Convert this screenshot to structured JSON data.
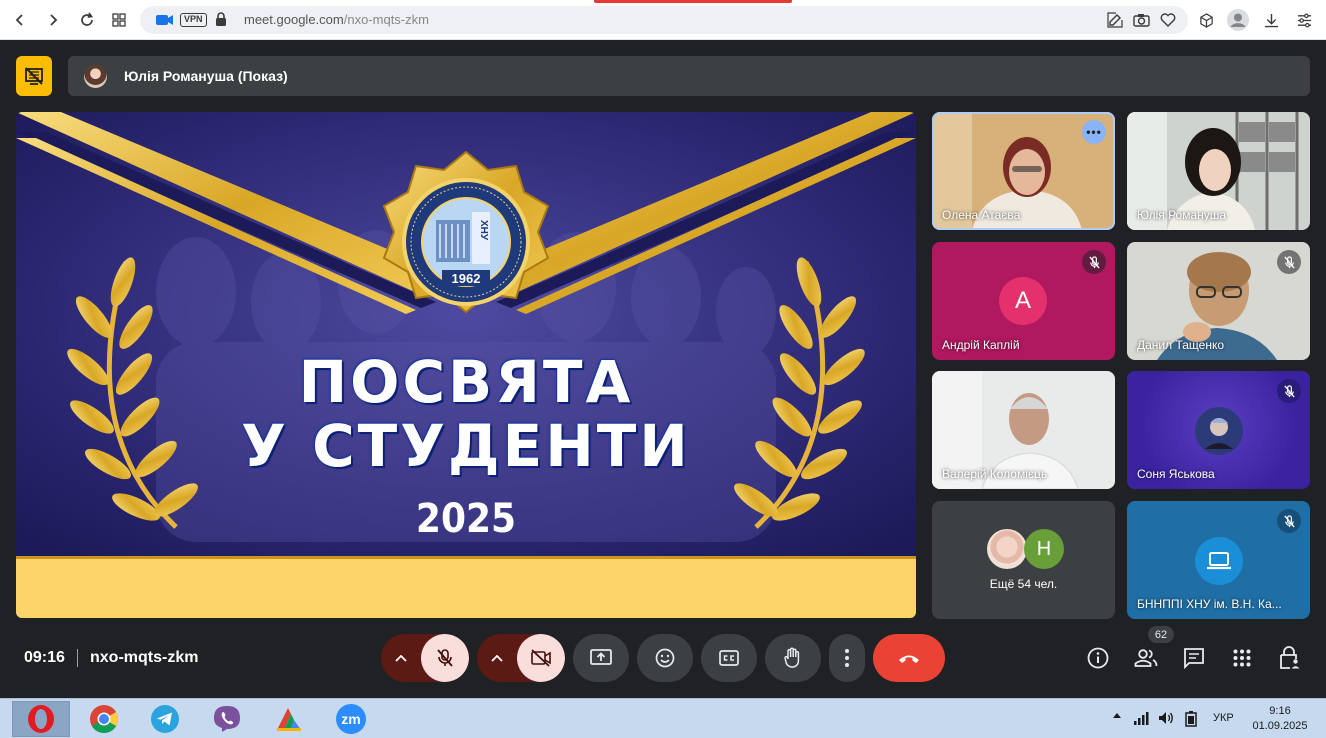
{
  "browser": {
    "url_host": "meet.google.com",
    "url_path": "/nxo-mqts-zkm",
    "vpn_label": "VPN"
  },
  "meet": {
    "presenter_label": "Юлія Романуша (Показ)",
    "slide": {
      "title_line1": "ПОСВЯТА",
      "title_line2": "У СТУДЕНТИ",
      "year": "2025",
      "logo_year": "1962",
      "logo_letters": "ХНУ"
    },
    "participants": [
      {
        "name": "Олена Атаєва",
        "speaking": true
      },
      {
        "name": "Юлія Романуша"
      },
      {
        "name": "Андрій Каплій",
        "initial": "А"
      },
      {
        "name": "Данил Тащенко"
      },
      {
        "name": "Валерій Коломієць"
      },
      {
        "name": "Соня Яськова"
      },
      {
        "name": "БННППІ ХНУ ім. В.Н. Ка..."
      }
    ],
    "others": {
      "label": "Ещё 54 чел.",
      "initial": "Н"
    },
    "footer": {
      "time": "09:16",
      "meeting_code": "nxo-mqts-zkm",
      "people_count": "62"
    },
    "colors": {
      "end_call": "#ea4335",
      "mic_off_bg": "#f9dedc",
      "accent": "#8ab4f8"
    }
  },
  "taskbar": {
    "language": "УКР",
    "clock_time": "9:16",
    "clock_date": "01.09.2025",
    "apps": [
      "opera",
      "chrome",
      "telegram",
      "viber",
      "chrome-remote",
      "zoom"
    ],
    "zoom_label": "zm"
  }
}
